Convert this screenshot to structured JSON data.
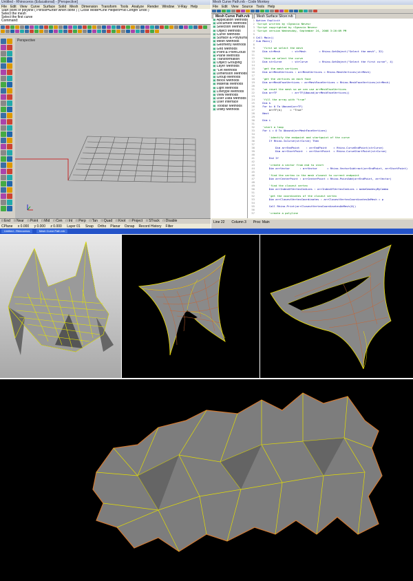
{
  "rhino": {
    "title": "Untitled - Rhinoceros (Educational) - [Perspective]",
    "menus": [
      "File",
      "Edit",
      "View",
      "Curve",
      "Surface",
      "Solid",
      "Mesh",
      "Dimension",
      "Transform",
      "Tools",
      "Analyze",
      "Render",
      "Window",
      "V-Ray",
      "Help"
    ],
    "command_history": [
      "Start point of polyline ( Persist=Enter when done ) ( Close  Mode=Line  Helpers=No  Length  Undo )",
      "Select the mesh",
      "Select the first curve",
      "Command:"
    ],
    "viewport_label": "Perspective",
    "osnaps": [
      "End",
      "Near",
      "Point",
      "Mid",
      "Cen",
      "Int",
      "Perp",
      "Tan",
      "Quad",
      "Knot",
      "Project",
      "STrack",
      "Disable"
    ],
    "status": {
      "cplane": "CPlane",
      "x": "x 0.000",
      "y": "y 0.000",
      "z": "z 0.000",
      "layer": "Layer 01",
      "items": [
        "Snap",
        "Ortho",
        "Planar",
        "Osnap",
        "Record History",
        "Filter"
      ]
    }
  },
  "editor": {
    "title": "Mesh Curve Path.rvb - Code Monkey",
    "menus": [
      "File",
      "Edit",
      "View",
      "Source",
      "Tools",
      "Help"
    ],
    "tabs": [
      "Mesh Curve Path.rvb",
      "Mesh Surface Slicer.rvb"
    ],
    "tree_items": [
      "Application Methods",
      "Document Methods",
      "Selection Methods",
      "Object Methods",
      "Curve Methods",
      "Surface & Polysurface",
      "Mesh Methods",
      "Geometry Methods",
      "Grid Methods",
      "Point & PointCloud",
      "Plane Methods",
      "Transformation",
      "Object Grouping",
      "Layer Methods",
      "*Let Methods",
      "Dimension Methods",
      "Group Methods",
      "Block Methods",
      "Material Methods",
      "Light Methods",
      "Linetype Methods",
      "View Methods",
      "User Data Methods",
      "User Interface",
      "Toolbar Methods",
      "Utility Methods"
    ],
    "code": [
      {
        "n": "1",
        "t": "Option Explicit"
      },
      {
        "n": "2",
        "t": "'Script written by <Ignacio Neves>"
      },
      {
        "n": "3",
        "t": "'Script copyrighted by <Ignacio Neves>"
      },
      {
        "n": "4",
        "t": "'Script version Wednesday, September 24, 2008 3:20:09 PM"
      },
      {
        "n": "5",
        "t": ""
      },
      {
        "n": "6",
        "t": "Call Main()"
      },
      {
        "n": "7",
        "t": "Sub Main()"
      },
      {
        "n": "8",
        "t": ""
      },
      {
        "n": "9",
        "t": "    'first we select the mesh"
      },
      {
        "n": "10",
        "t": "    Dim strMesh       : strMesh        = Rhino.GetObject(\"Select the mesh\", 32)"
      },
      {
        "n": "11",
        "t": ""
      },
      {
        "n": "12",
        "t": "    'then we select the curve"
      },
      {
        "n": "13",
        "t": "    Dim strCurve      : strCurve       = Rhino.GetObject(\"Select the first curve\", 4)"
      },
      {
        "n": "14",
        "t": ""
      },
      {
        "n": "15",
        "t": "    'get the mesh vertices"
      },
      {
        "n": "16",
        "t": "    Dim arrMeshVertices : arrMeshVertices = Rhino.MeshVertices(strMesh)"
      },
      {
        "n": "17",
        "t": ""
      },
      {
        "n": "18",
        "t": "    'get the vertices on each face"
      },
      {
        "n": "19",
        "t": "    Dim arrMeshFaceVertices : arrMeshFaceVertices = Rhino.MeshFaceVertices(strMesh)"
      },
      {
        "n": "20",
        "t": ""
      },
      {
        "n": "21",
        "t": "    'we reset the mesh so we can use arrMeshFaceVertices"
      },
      {
        "n": "22",
        "t": "    Dim arrTF         : arrTF(Ubound(arrMeshFaceVertices))"
      },
      {
        "n": "23",
        "t": ""
      },
      {
        "n": "24",
        "t": "    'fill the array with \"true\""
      },
      {
        "n": "25",
        "t": "    Dim k"
      },
      {
        "n": "26",
        "t": "    For k= 0 To Ubound(arrTF)"
      },
      {
        "n": "27",
        "t": "        arrTF(k)     = \"True\""
      },
      {
        "n": "28",
        "t": "    Next"
      },
      {
        "n": "29",
        "t": ""
      },
      {
        "n": "30",
        "t": "    Dim i"
      },
      {
        "n": "31",
        "t": ""
      },
      {
        "n": "32",
        "t": "    'start a loop"
      },
      {
        "n": "33",
        "t": "    For i = 0 To Ubound(arrMeshFaceVertices)"
      },
      {
        "n": "34",
        "t": ""
      },
      {
        "n": "35",
        "t": "        'identify the endpoint and startpoint of the curve"
      },
      {
        "n": "36",
        "t": "        If Rhino.IsCurve(strCurve) Then"
      },
      {
        "n": "37",
        "t": ""
      },
      {
        "n": "38",
        "t": "            Dim arrEndPoint    : arrEndPoint    = Rhino.CurveEndPoint(strCurve)"
      },
      {
        "n": "39",
        "t": "            Dim arrStartPoint  : arrStartPoint  = Rhino.CurveStartPoint(strCurve)"
      },
      {
        "n": "40",
        "t": ""
      },
      {
        "n": "41",
        "t": "        End If"
      },
      {
        "n": "42",
        "t": ""
      },
      {
        "n": "43",
        "t": "        'create a vector from end to start"
      },
      {
        "n": "44",
        "t": "        Dim arrVector      : arrVector      = Rhino.VectorSubtract(arrEndPoint, arrStartPoint)"
      },
      {
        "n": "45",
        "t": ""
      },
      {
        "n": "46",
        "t": "        'find the vertex in the mesh closest to current endpoint"
      },
      {
        "n": "47",
        "t": "        Dim arrCenterPoint : arrCenterPoint = Rhino.PointAdd(arrEndPoint, arrVector)"
      },
      {
        "n": "48",
        "t": ""
      },
      {
        "n": "49",
        "t": "        'find the closest vertex"
      },
      {
        "n": "50",
        "t": "        Dim arrIndexOfVertexIndices : arrIndexOfVertexIndices = makeGeodesyByCombo"
      },
      {
        "n": "51",
        "t": ""
      },
      {
        "n": "52",
        "t": "        'get the coordinates of the closest vertex"
      },
      {
        "n": "53",
        "t": "        Dim arrClosestVertexCoordinates : arrClosestVertexCoordinatesOnMesh = p"
      },
      {
        "n": "54",
        "t": ""
      },
      {
        "n": "55",
        "t": "        Call Rhino.Print(arrClosestVertexCoordinatesOnMesh(0))"
      },
      {
        "n": "56",
        "t": ""
      },
      {
        "n": "57",
        "t": "        'create a polyline"
      }
    ],
    "status": [
      "Line 22",
      "Column 3",
      "Proc: Main"
    ]
  },
  "taskbar": [
    "Untitled - Rhinoceros",
    "Mesh Curve Path.rvb"
  ],
  "icons": {
    "toolbar": "tool-icon",
    "left_toolbar": "modeling-tool-icon"
  }
}
